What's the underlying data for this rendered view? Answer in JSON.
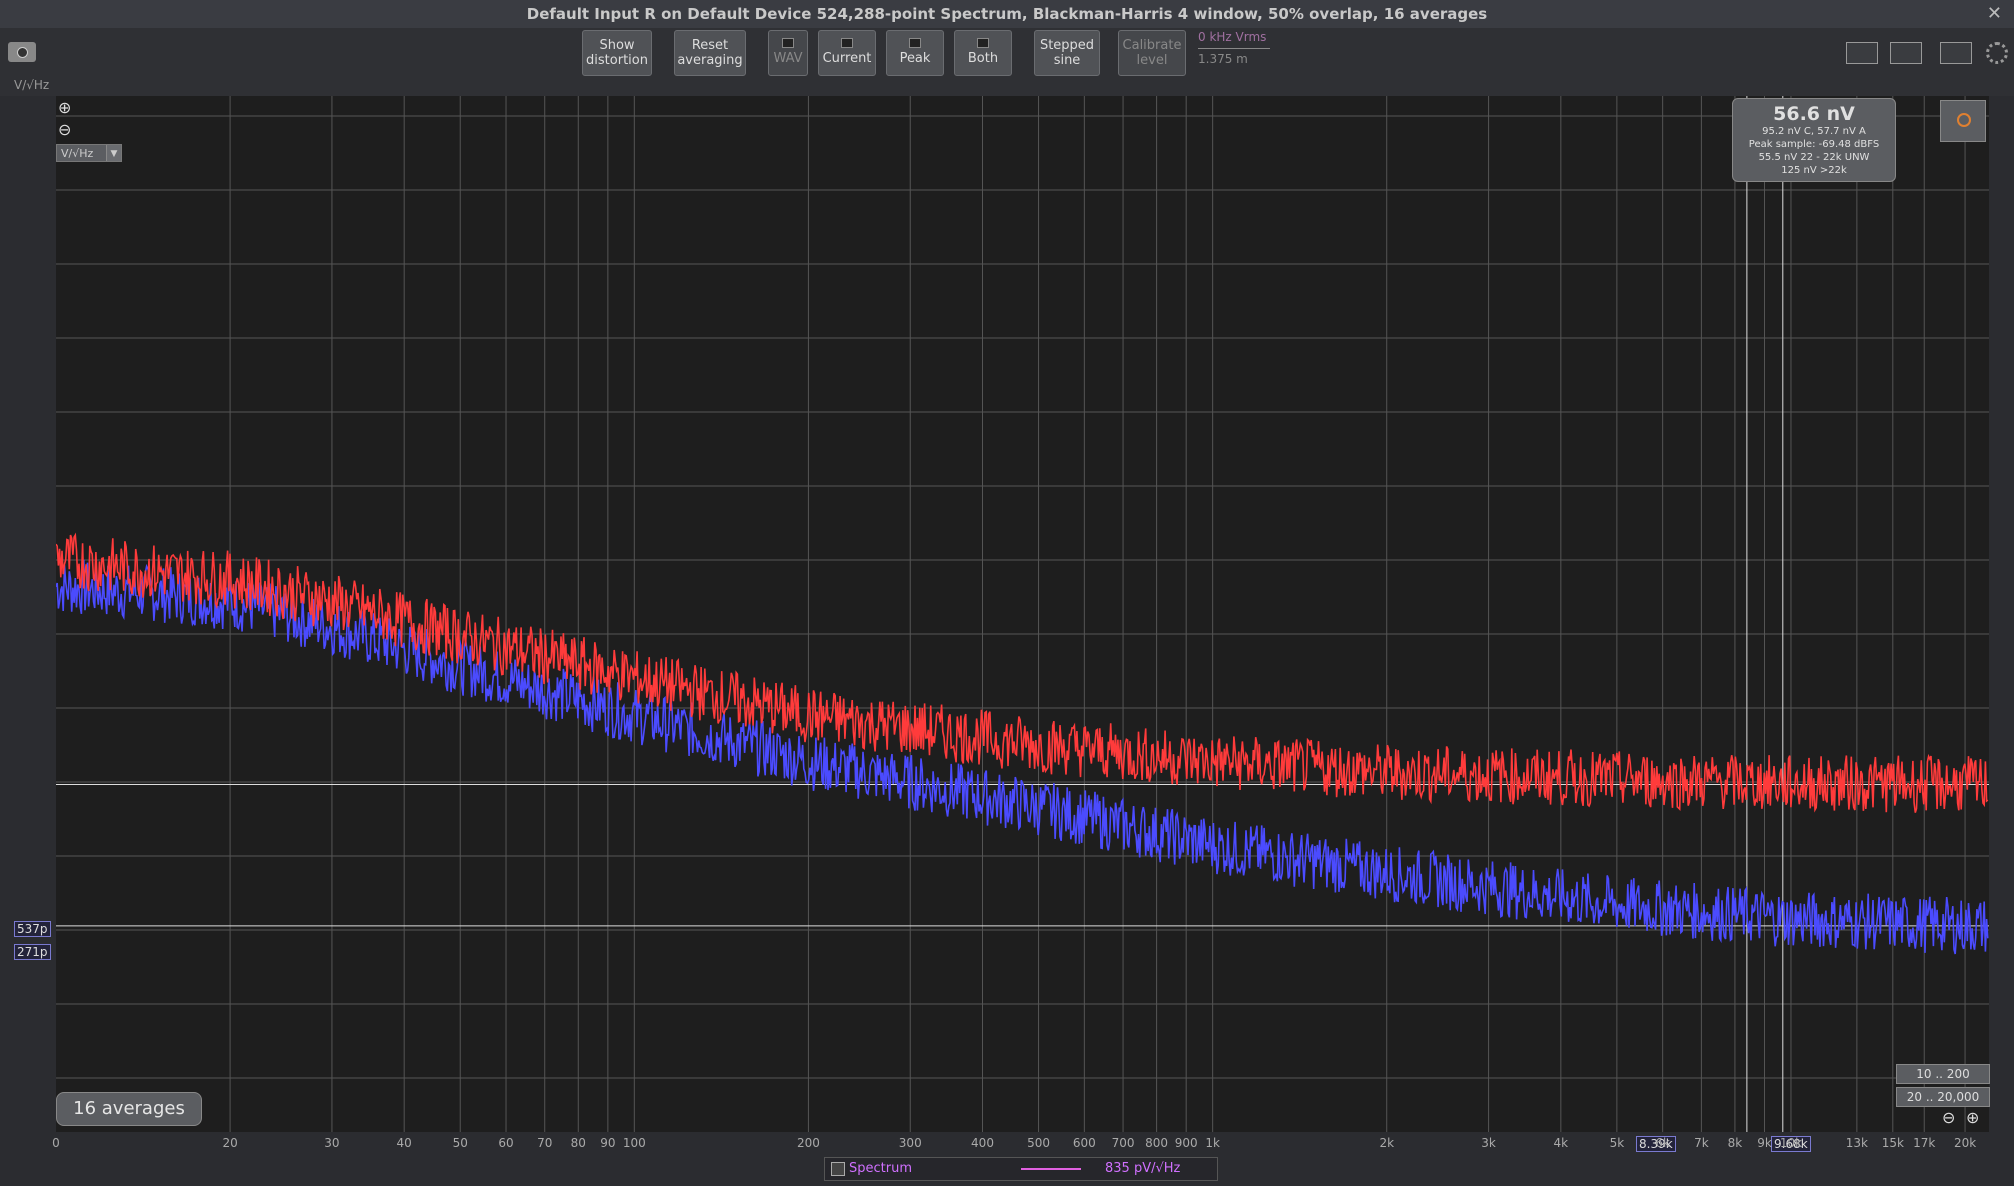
{
  "window": {
    "title": "Default Input R on Default Device 524,288-point Spectrum, Blackman-Harris 4 window, 50% overlap, 16 averages",
    "close_label": "✕"
  },
  "toolbar": {
    "show_distortion": "Show distortion",
    "reset_averaging": "Reset averaging",
    "wav": "WAV",
    "current": "Current",
    "peak": "Peak",
    "both": "Both",
    "stepped_sine": "Stepped sine",
    "calibrate_level": "Calibrate level",
    "level_label": "0 kHz Vrms",
    "level_value": "1.375 m"
  },
  "plot": {
    "unit_label": "V/√Hz",
    "unit_dropdown": "V/√Hz",
    "marker_a": "537p",
    "marker_b": "271p",
    "cursor_a_label": "8.39k",
    "cursor_b_label": "9.68k",
    "zoom_in": "⊕",
    "zoom_out": "⊖",
    "readout": {
      "main": "56.6 nV",
      "line1": "95.2 nV C, 57.7 nV A",
      "line2": "Peak sample: -69.48 dBFS",
      "line3": "55.5 nV 22 - 22k UNW",
      "line4": "125 nV >22k"
    },
    "averages_badge": "16 averages",
    "range_1": "10 .. 200",
    "range_2": "20 .. 20,000",
    "x_tick_labels": [
      "0",
      "20",
      "30",
      "40",
      "50",
      "60",
      "70",
      "80",
      "90",
      "100",
      "200",
      "300",
      "400",
      "500",
      "600",
      "700",
      "800",
      "900",
      "1k",
      "2k",
      "3k",
      "4k",
      "5k",
      "6k",
      "7k",
      "8k",
      "9k",
      "10k",
      "13k",
      "15k",
      "17k",
      "20k"
    ]
  },
  "legend": {
    "name": "Spectrum",
    "value": "835 pV/√Hz"
  },
  "chart_data": {
    "type": "line",
    "x_scale": "log",
    "xlim": [
      10,
      22000
    ],
    "y_scale": "log",
    "series": [
      {
        "color": "#ff3b3b",
        "x": [
          10,
          15,
          20,
          30,
          50,
          100,
          200,
          500,
          1000,
          2000,
          5000,
          10000,
          20000
        ],
        "values": [
          1.6e-09,
          1.5e-09,
          1.45e-09,
          1.3e-09,
          1.1e-09,
          9e-10,
          7.5e-10,
          6.5e-10,
          6e-10,
          5.7e-10,
          5.5e-10,
          5.4e-10,
          5.37e-10
        ]
      },
      {
        "color": "#4b4bff",
        "x": [
          10,
          15,
          20,
          30,
          50,
          100,
          200,
          500,
          1000,
          2000,
          5000,
          10000,
          20000
        ],
        "values": [
          1.4e-09,
          1.35e-09,
          1.3e-09,
          1.15e-09,
          9.5e-10,
          7.5e-10,
          6e-10,
          4.8e-10,
          4e-10,
          3.5e-10,
          3e-10,
          2.8e-10,
          2.71e-10
        ]
      }
    ]
  }
}
